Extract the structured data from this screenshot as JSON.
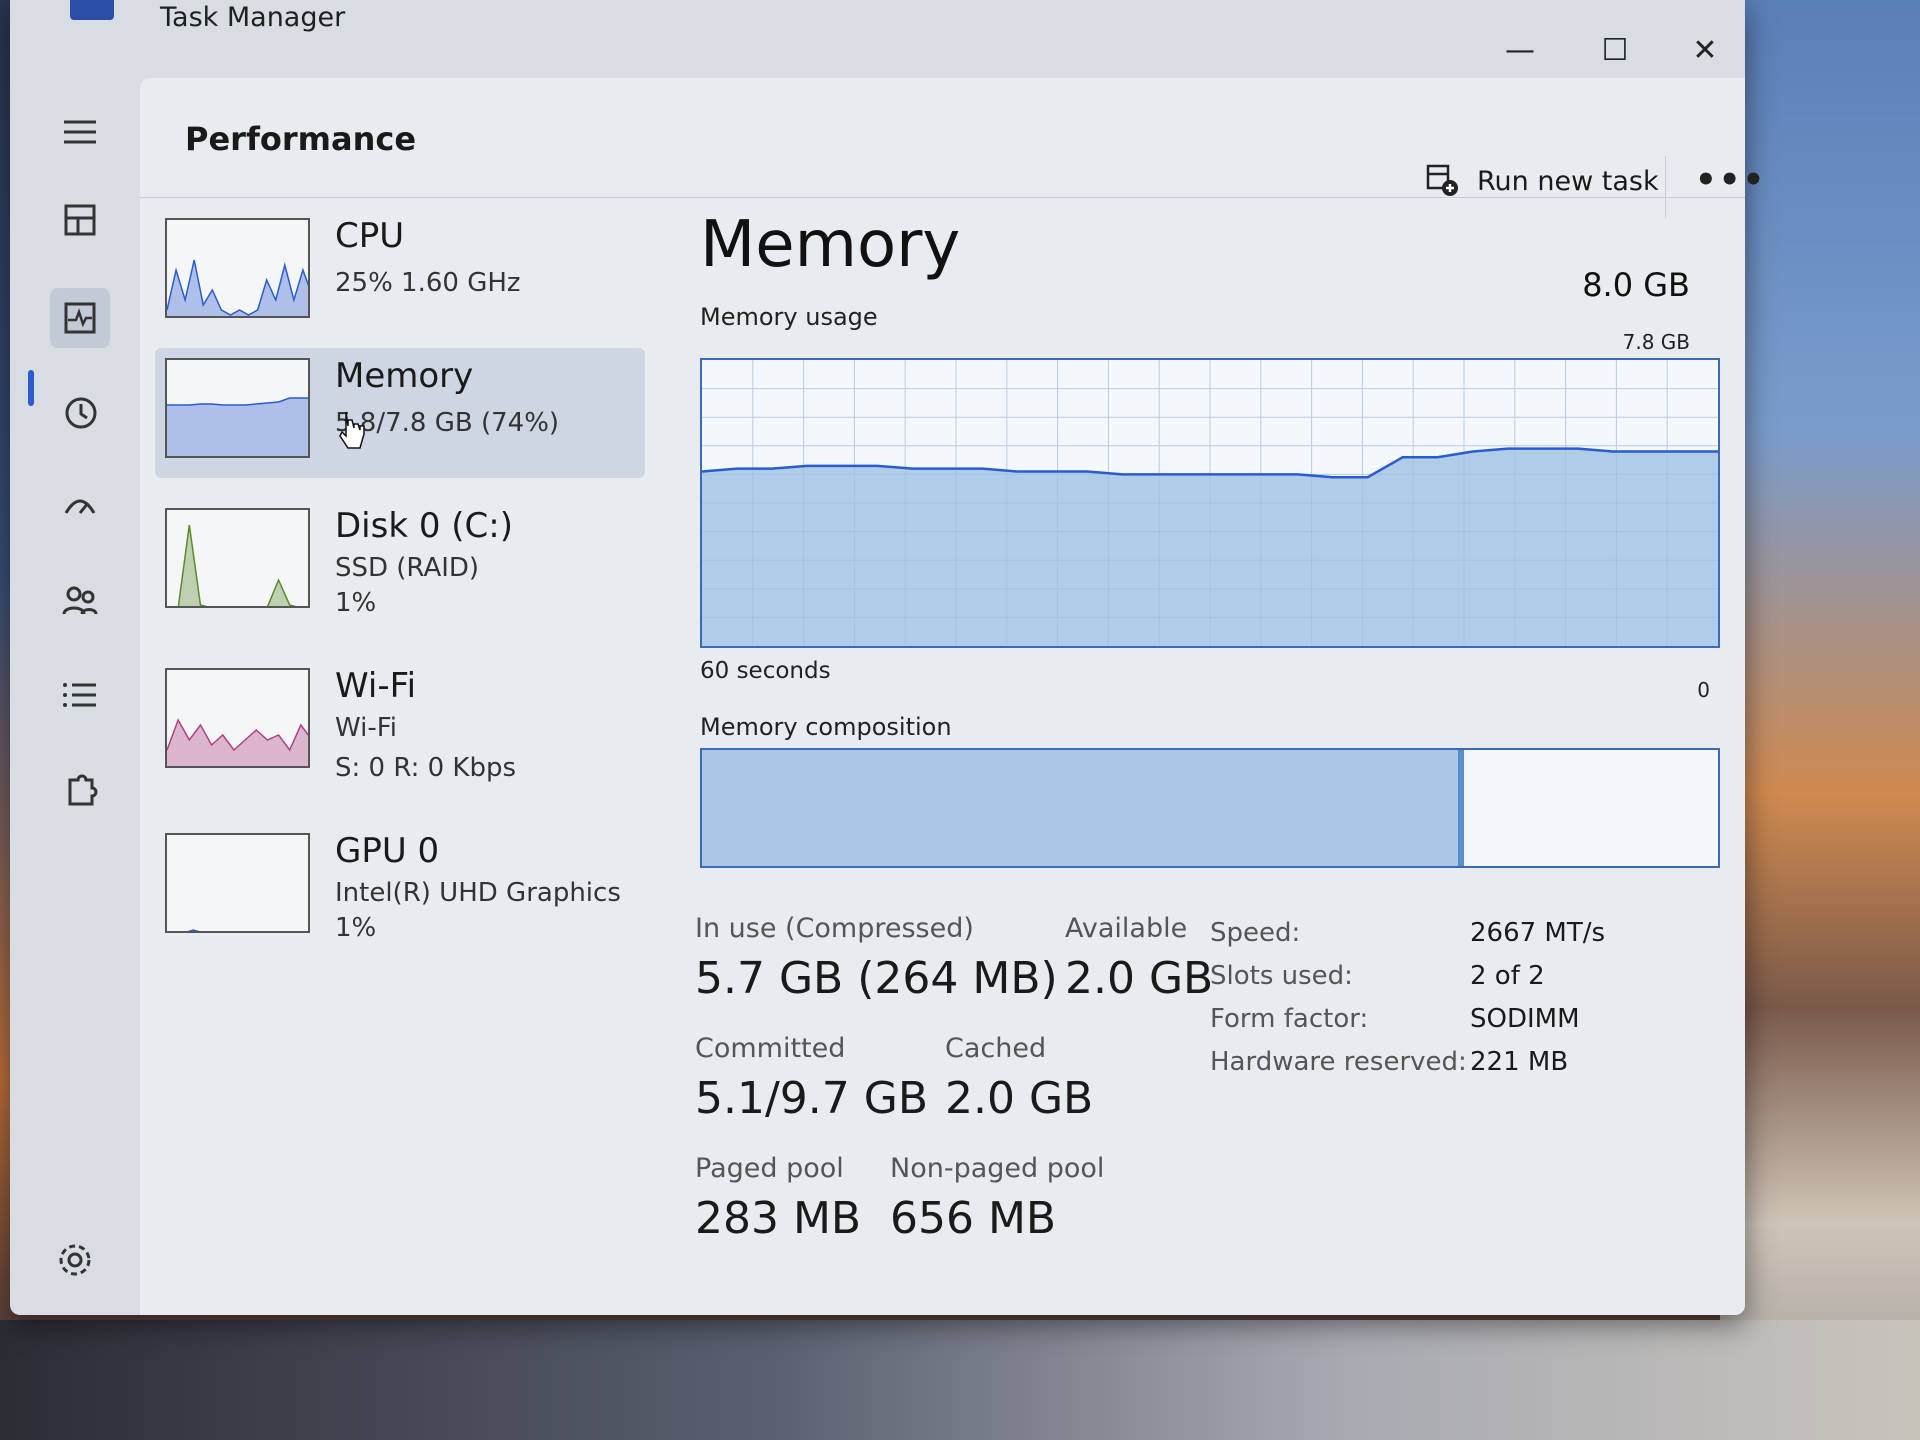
{
  "window": {
    "title": "Task Manager"
  },
  "controls": {
    "minimize": "—",
    "maximize": "☐",
    "close": "✕"
  },
  "header": {
    "title": "Performance",
    "run_task_label": "Run new task",
    "more": "•••"
  },
  "devices": [
    {
      "name": "CPU",
      "line1": "25%  1.60 GHz",
      "line2": "",
      "color": "#2b5bd0"
    },
    {
      "name": "Memory",
      "line1": "5.8/7.8 GB (74%)",
      "line2": "",
      "color": "#2b5bd0"
    },
    {
      "name": "Disk 0 (C:)",
      "line1": "SSD (RAID)",
      "line2": "1%",
      "color": "#5a8a2a"
    },
    {
      "name": "Wi-Fi",
      "line1": "Wi-Fi",
      "line2": "S: 0 R: 0 Kbps",
      "color": "#b04080"
    },
    {
      "name": "GPU 0",
      "line1": "Intel(R) UHD Graphics",
      "line2": "1%",
      "color": "#2b5bd0"
    }
  ],
  "memory": {
    "title": "Memory",
    "total": "8.0 GB",
    "usage_label": "Memory usage",
    "usage_max": "7.8 GB",
    "axis_left": "60 seconds",
    "axis_right": "0",
    "composition_label": "Memory composition",
    "composition_used_fraction": 0.75,
    "stats": {
      "in_use_label": "In use (Compressed)",
      "in_use_value": "5.7 GB (264 MB)",
      "available_label": "Available",
      "available_value": "2.0 GB",
      "committed_label": "Committed",
      "committed_value": "5.1/9.7 GB",
      "cached_label": "Cached",
      "cached_value": "2.0 GB",
      "paged_label": "Paged pool",
      "paged_value": "283 MB",
      "nonpaged_label": "Non-paged pool",
      "nonpaged_value": "656 MB"
    },
    "specs": [
      {
        "label": "Speed:",
        "value": "2667 MT/s"
      },
      {
        "label": "Slots used:",
        "value": "2 of 2"
      },
      {
        "label": "Form factor:",
        "value": "SODIMM"
      },
      {
        "label": "Hardware reserved:",
        "value": "221 MB"
      }
    ],
    "usage_history": [
      0.61,
      0.62,
      0.62,
      0.63,
      0.63,
      0.63,
      0.62,
      0.62,
      0.62,
      0.61,
      0.61,
      0.61,
      0.6,
      0.6,
      0.6,
      0.6,
      0.6,
      0.6,
      0.59,
      0.59,
      0.66,
      0.66,
      0.68,
      0.69,
      0.69,
      0.69,
      0.68,
      0.68,
      0.68,
      0.68
    ]
  }
}
